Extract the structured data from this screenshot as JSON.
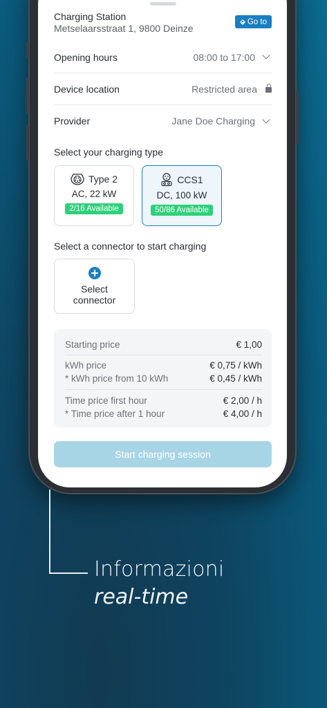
{
  "station": {
    "title": "Charging Station",
    "address": "Metselaarsstraat 1, 9800 Deinze",
    "goto_label": "Go to"
  },
  "info_rows": [
    {
      "label": "Opening hours",
      "value": "08:00 to 17:00",
      "icon": "chevron-down-icon"
    },
    {
      "label": "Device location",
      "value": "Restricted area",
      "icon": "lock-icon"
    },
    {
      "label": "Provider",
      "value": "Jane Doe Charging",
      "icon": "chevron-down-icon"
    }
  ],
  "charging_type": {
    "title": "Select your charging type",
    "types": [
      {
        "name": "Type 2",
        "spec": "AC, 22 kW",
        "availability": "2/16 Available",
        "selected": false
      },
      {
        "name": "CCS1",
        "spec": "DC, 100 kW",
        "availability": "50/86 Available",
        "selected": true
      }
    ]
  },
  "connector": {
    "title": "Select a connector to start charging",
    "card_line1": "Select",
    "card_line2": "connector"
  },
  "pricing": {
    "starting_label": "Starting price",
    "starting_value": "€ 1,00",
    "kwh_label": "kWh price",
    "kwh_value": "€ 0,75 / kWh",
    "kwh_from_label": "* kWh price from 10 kWh",
    "kwh_from_value": "€ 0,45 / kWh",
    "time_first_label": "Time price first hour",
    "time_first_value": "€ 2,00 / h",
    "time_after_label": "* Time price after 1 hour",
    "time_after_value": "€ 4,00 / h"
  },
  "start_button_label": "Start charging session",
  "caption": {
    "line1": "Informazioni",
    "line2": "real-time"
  },
  "colors": {
    "accent": "#1a7fc1",
    "available": "#2fd07a",
    "disabled_button": "#a8d5e5"
  }
}
